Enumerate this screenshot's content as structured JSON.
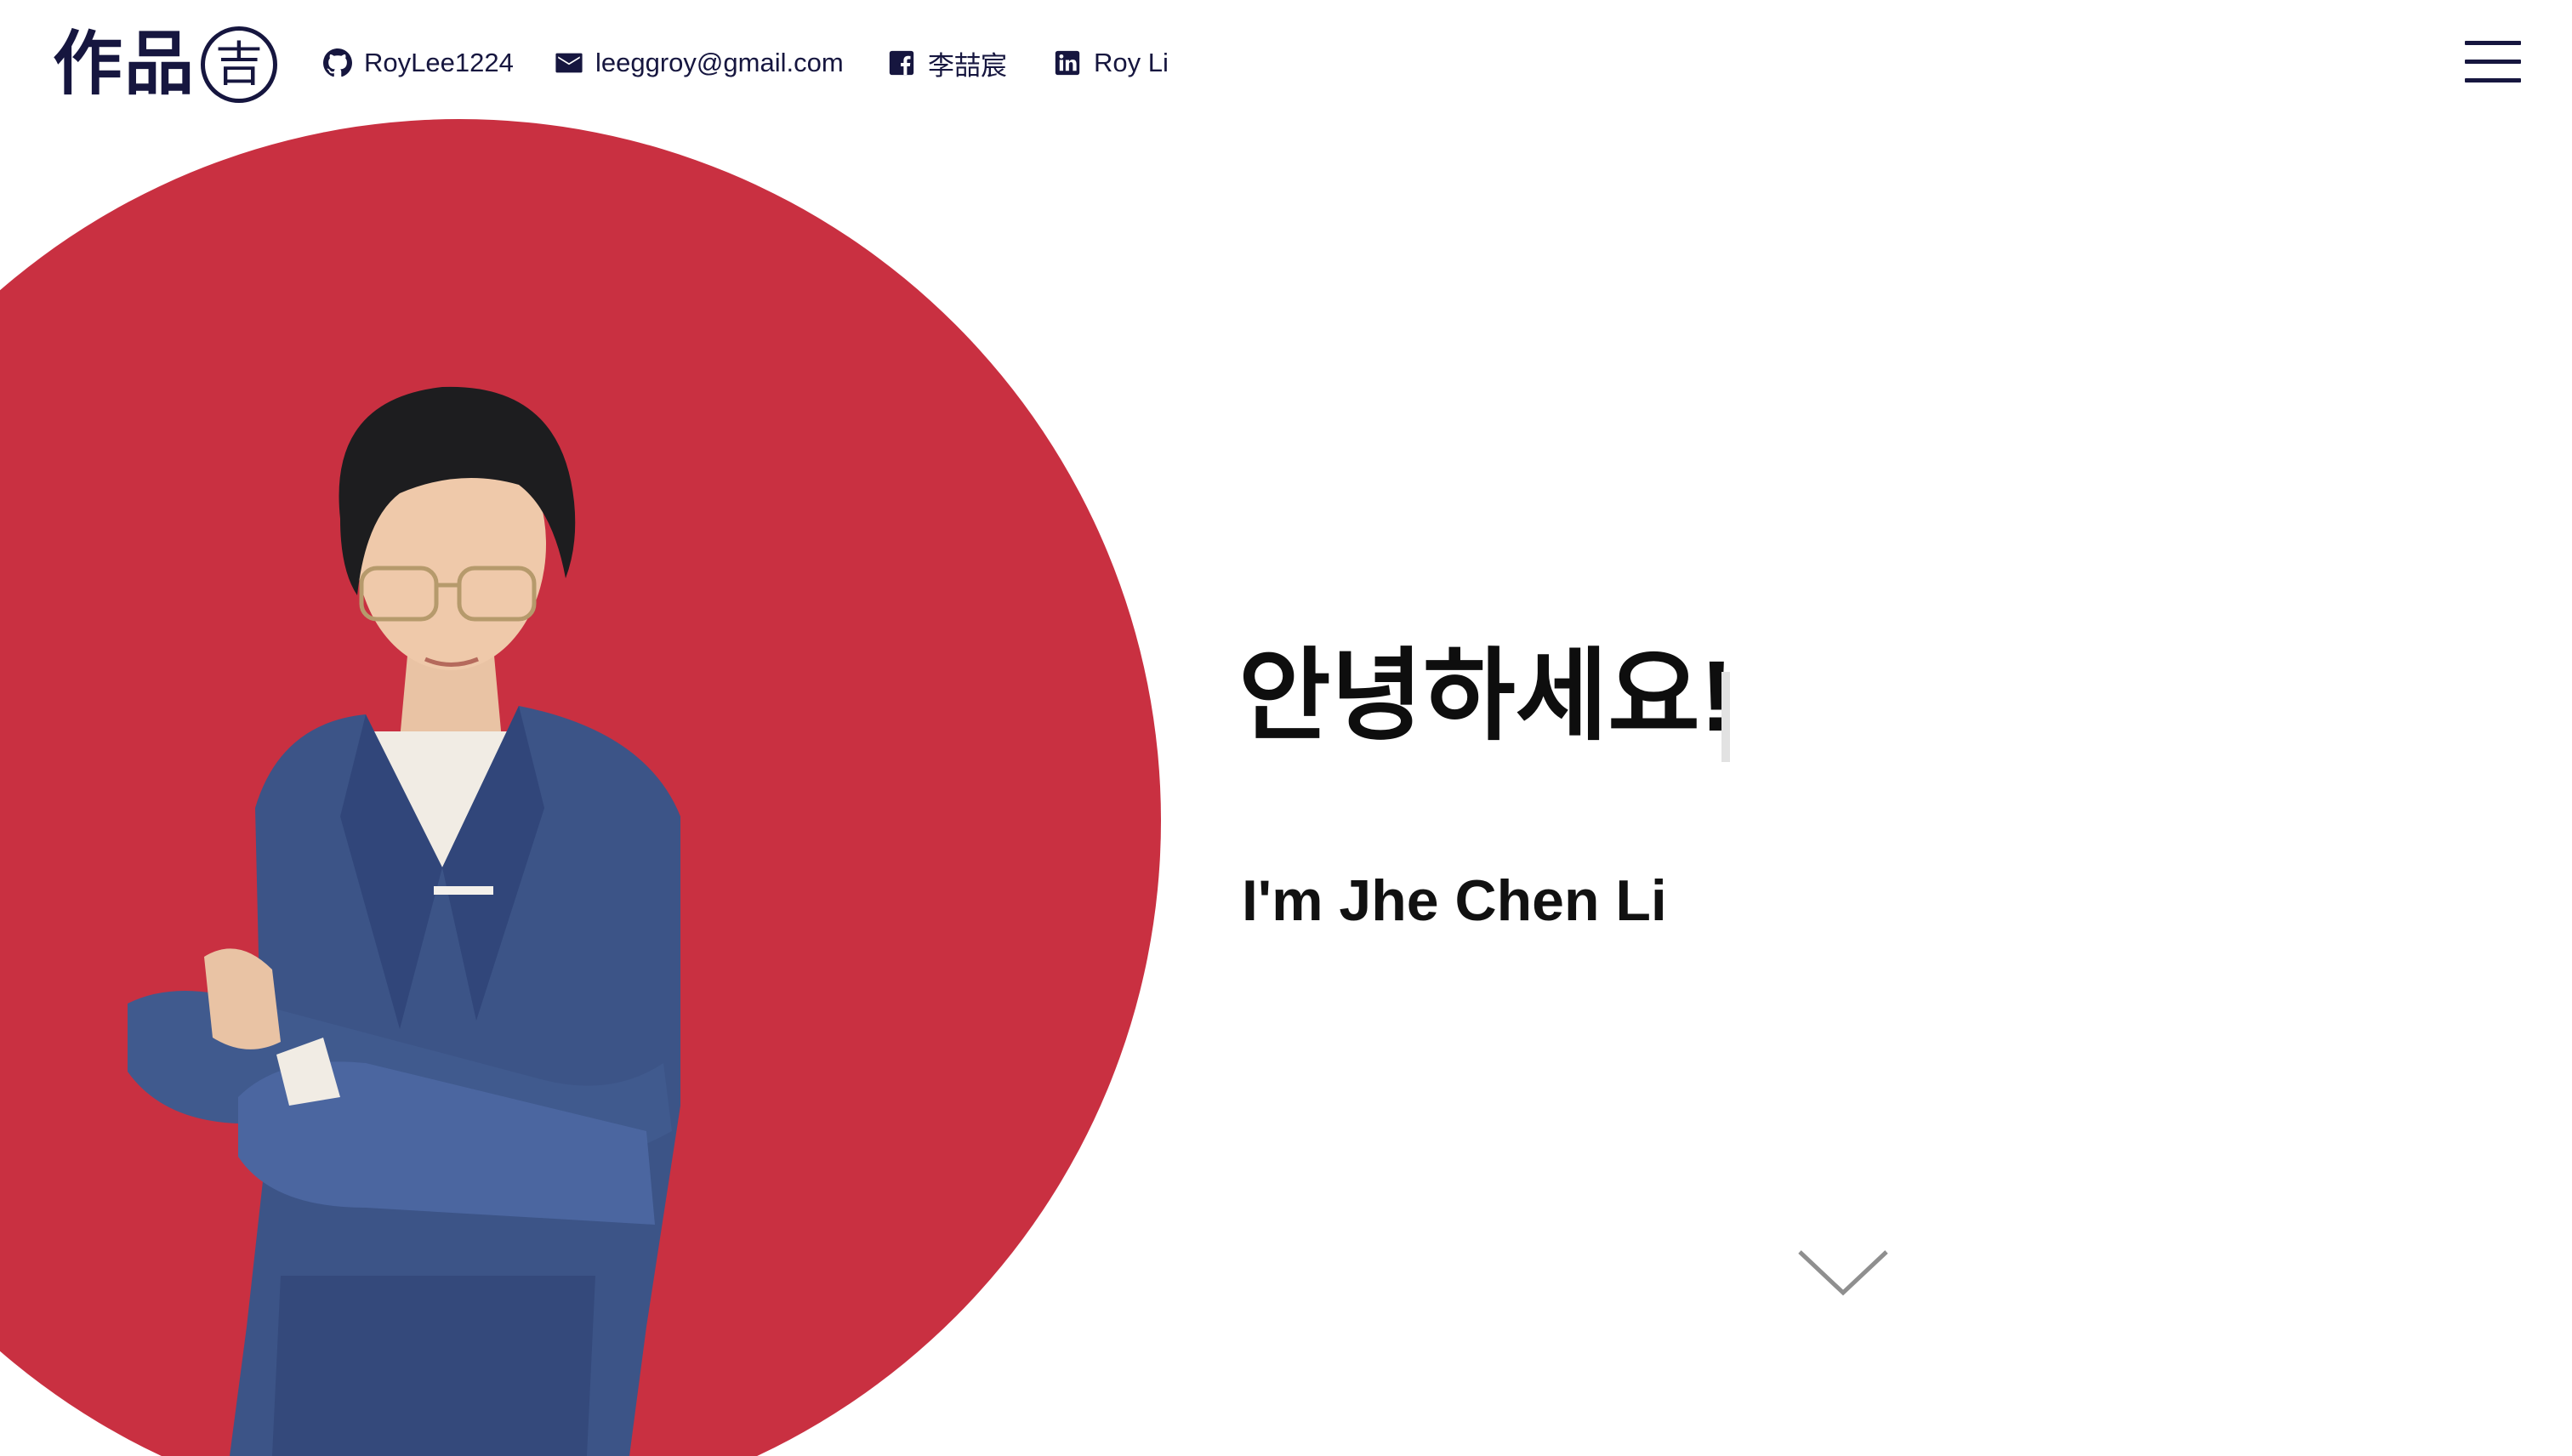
{
  "header": {
    "logo_text": "作品",
    "logo_seal": "吉",
    "social": [
      {
        "icon": "github-icon",
        "label": "RoyLee1224"
      },
      {
        "icon": "mail-icon",
        "label": "leeggroy@gmail.com"
      },
      {
        "icon": "facebook-icon",
        "label": "李喆宸"
      },
      {
        "icon": "linkedin-icon",
        "label": "Roy Li"
      }
    ],
    "menu_icon": "hamburger-menu-icon"
  },
  "hero": {
    "greeting": "안녕하세요!",
    "intro": "I'm Jhe Chen Li",
    "scroll_icon": "chevron-down-icon"
  },
  "colors": {
    "accent": "#c93041",
    "text": "#16163f",
    "background": "#ffffff"
  }
}
